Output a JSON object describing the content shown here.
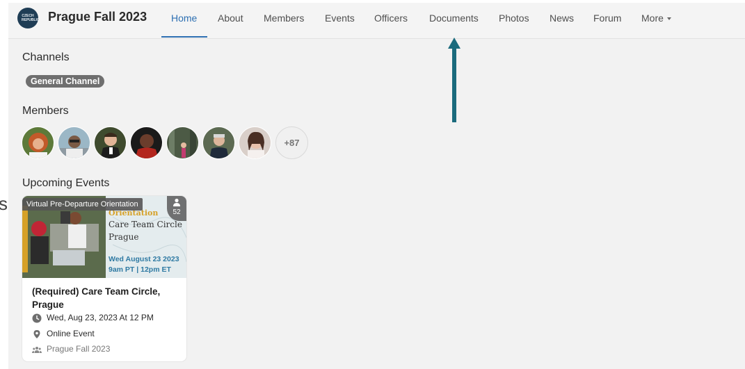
{
  "app": {
    "title": "Prague Fall 2023",
    "logo_text": "CZECH REPUBLIC"
  },
  "nav": {
    "items": [
      "Home",
      "About",
      "Members",
      "Events",
      "Officers",
      "Documents",
      "Photos",
      "News",
      "Forum",
      "More"
    ],
    "active": "Home"
  },
  "channels": {
    "heading": "Channels",
    "items": [
      "General Channel"
    ]
  },
  "members": {
    "heading": "Members",
    "more_count": "+87"
  },
  "events": {
    "heading": "Upcoming Events",
    "cards": [
      {
        "badge": "Virtual Pre-Departure Orientation",
        "attendees": "52",
        "poster_heading": "Orientation",
        "poster_line1": "Care Team Circle",
        "poster_line2": "Prague",
        "poster_date": "Wed August 23 2023",
        "poster_time": "9am PT | 12pm ET",
        "title": "(Required) Care Team Circle, Prague",
        "datetime": "Wed, Aug 23, 2023 At 12 PM",
        "location": "Online Event",
        "group": "Prague Fall 2023"
      }
    ]
  },
  "colors": {
    "accent": "#2d6fb2",
    "arrow": "#1b6b7d",
    "chip": "#6f6f6f"
  },
  "stray_text": "s"
}
